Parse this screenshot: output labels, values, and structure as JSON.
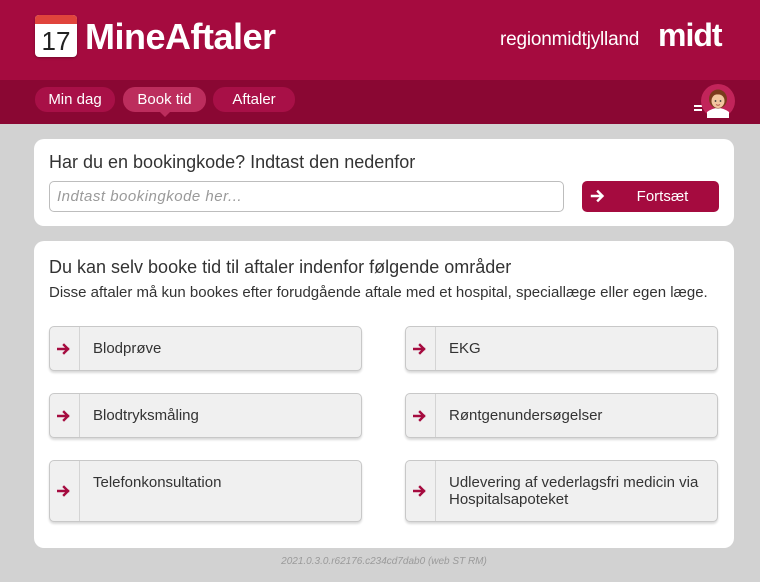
{
  "header": {
    "calendar_day": "17",
    "app_title": "MineAftaler",
    "region_name": "regionmidtjylland",
    "region_mark": "midt"
  },
  "nav": {
    "tabs": [
      {
        "label": "Min dag",
        "active": false
      },
      {
        "label": "Book tid",
        "active": true
      },
      {
        "label": "Aftaler",
        "active": false
      }
    ]
  },
  "booking": {
    "heading": "Har du en bookingkode? Indtast den nedenfor",
    "input_placeholder": "Indtast bookingkode her...",
    "input_value": "",
    "continue_label": "Fortsæt"
  },
  "areas": {
    "heading": "Du kan selv booke tid til aftaler indenfor følgende områder",
    "subtitle": "Disse aftaler må kun bookes efter forudgående aftale med et hospital, speciallæge eller egen læge.",
    "items": [
      {
        "label": "Blodprøve"
      },
      {
        "label": "EKG"
      },
      {
        "label": "Blodtryksmåling"
      },
      {
        "label": "Røntgenundersøgelser"
      },
      {
        "label": "Telefonkonsultation"
      },
      {
        "label": "Udlevering af vederlagsfri medicin via Hospitalsapoteket"
      }
    ]
  },
  "footer": {
    "version": "2021.0.3.0.r62176.c234cd7dab0 (web ST RM)"
  },
  "colors": {
    "brand": "#a50b3f",
    "nav_bar": "#8a0733",
    "background": "#d2d2d2"
  },
  "icons": [
    "calendar-icon",
    "arrow-right-icon",
    "menu-icon",
    "user-avatar-icon"
  ]
}
